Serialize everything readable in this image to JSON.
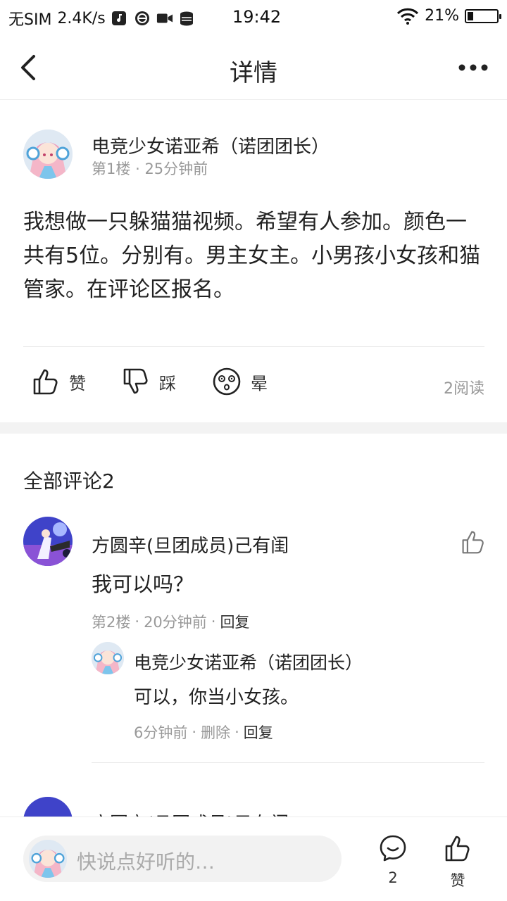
{
  "status_bar": {
    "carrier": "无SIM",
    "speed": "2.4K/s",
    "time": "19:42",
    "battery": "21%",
    "battery_level": 0.21,
    "icons": [
      "music-icon",
      "globe-icon",
      "video-icon",
      "data-icon",
      "wifi-icon",
      "battery-icon"
    ]
  },
  "nav": {
    "title": "详情",
    "back_icon": "back-chevron-icon",
    "more_icon": "more-dots-icon"
  },
  "post": {
    "author": "电竞少女诺亚希（诺团团长）",
    "floor": "第1楼",
    "dot": "·",
    "time": "25分钟前",
    "body": "我想做一只躲猫猫视频。希望有人参加。颜色一共有5位。分别有。男主女主。小男孩小女孩和猫管家。在评论区报名。",
    "actions": {
      "like": "赞",
      "dislike": "踩",
      "dizzy": "晕"
    },
    "reads": "2阅读"
  },
  "comments": {
    "title": "全部评论2",
    "items": [
      {
        "author": "方圆辛(旦团成员)己有闺",
        "text": "我可以吗？",
        "floor": "第2楼",
        "time": "20分钟前",
        "reply_label": "回复",
        "replies": [
          {
            "author": "电竞少女诺亚希（诺团团长）",
            "text": "可以，你当小女孩。",
            "time": "6分钟前",
            "delete_label": "删除",
            "reply_label": "回复"
          }
        ]
      },
      {
        "author": "方圆辛(旦团成员)己有闺"
      }
    ]
  },
  "bottom_bar": {
    "placeholder": "快说点好听的…",
    "comment_count": "2",
    "like_label": "赞"
  },
  "colors": {
    "text_primary": "#222222",
    "text_secondary": "#999999",
    "divider": "#e8e8e8",
    "band": "#f3f3f3",
    "input_bg": "#f2f2f2"
  }
}
